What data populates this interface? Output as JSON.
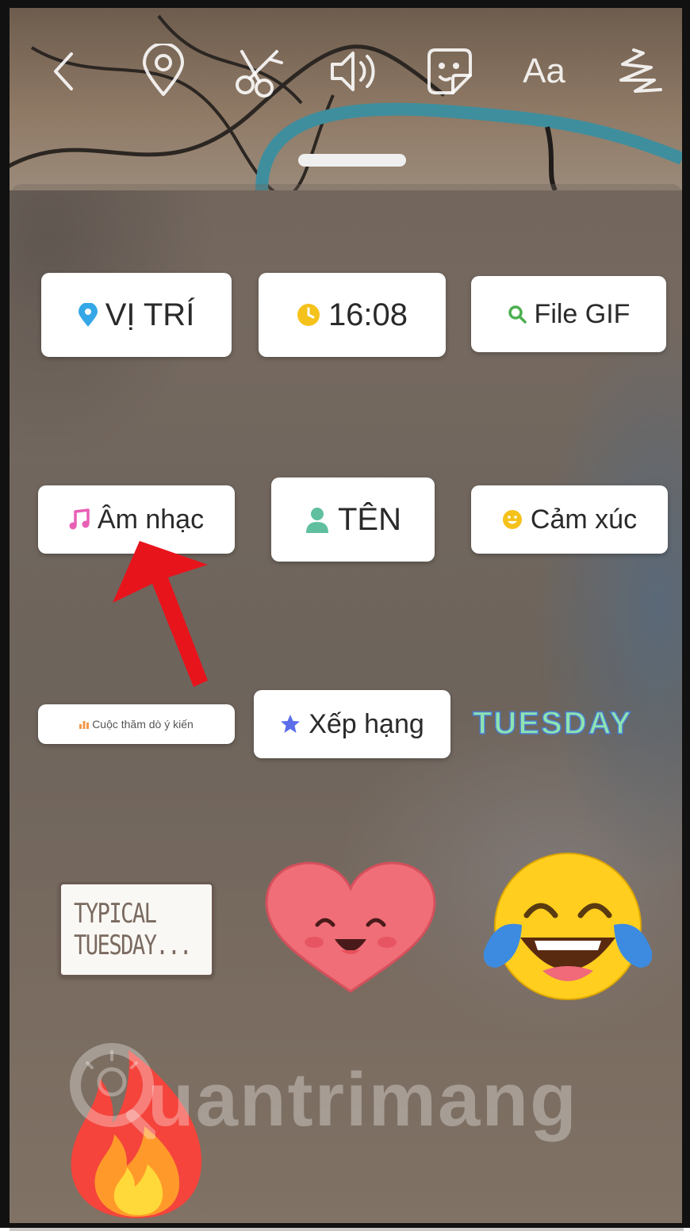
{
  "toolbar": {
    "items": [
      {
        "icon": "back-chevron-icon"
      },
      {
        "icon": "location-pin-icon"
      },
      {
        "icon": "scissors-icon"
      },
      {
        "icon": "speaker-icon"
      },
      {
        "icon": "sticker-icon"
      },
      {
        "icon": "text-icon",
        "label": "Aa"
      },
      {
        "icon": "draw-squiggle-icon"
      }
    ]
  },
  "stickers": {
    "location": {
      "label": "VỊ TRÍ",
      "icon_color": "#34a7e6"
    },
    "time": {
      "label": "16:08",
      "icon_color": "#f5c21b"
    },
    "gif": {
      "label": "File GIF",
      "icon_color": "#4caf50"
    },
    "music": {
      "label": "Âm nhạc",
      "icon_color": "#e85fb5"
    },
    "name": {
      "label": "TÊN",
      "icon_color": "#5fbf9f"
    },
    "feeling": {
      "label": "Cảm xúc",
      "icon_color": "#f5c21b"
    },
    "poll": {
      "label": "Cuộc thăm dò ý kiến",
      "icon_color": "#f2994a"
    },
    "rating": {
      "label": "Xếp hạng",
      "icon_color": "#5b6ee8"
    },
    "tuesday": {
      "label": "TUESDAY"
    },
    "typical": {
      "line1": "TYPICAL",
      "line2": "TUESDAY..."
    }
  },
  "watermark": "uantrimang"
}
